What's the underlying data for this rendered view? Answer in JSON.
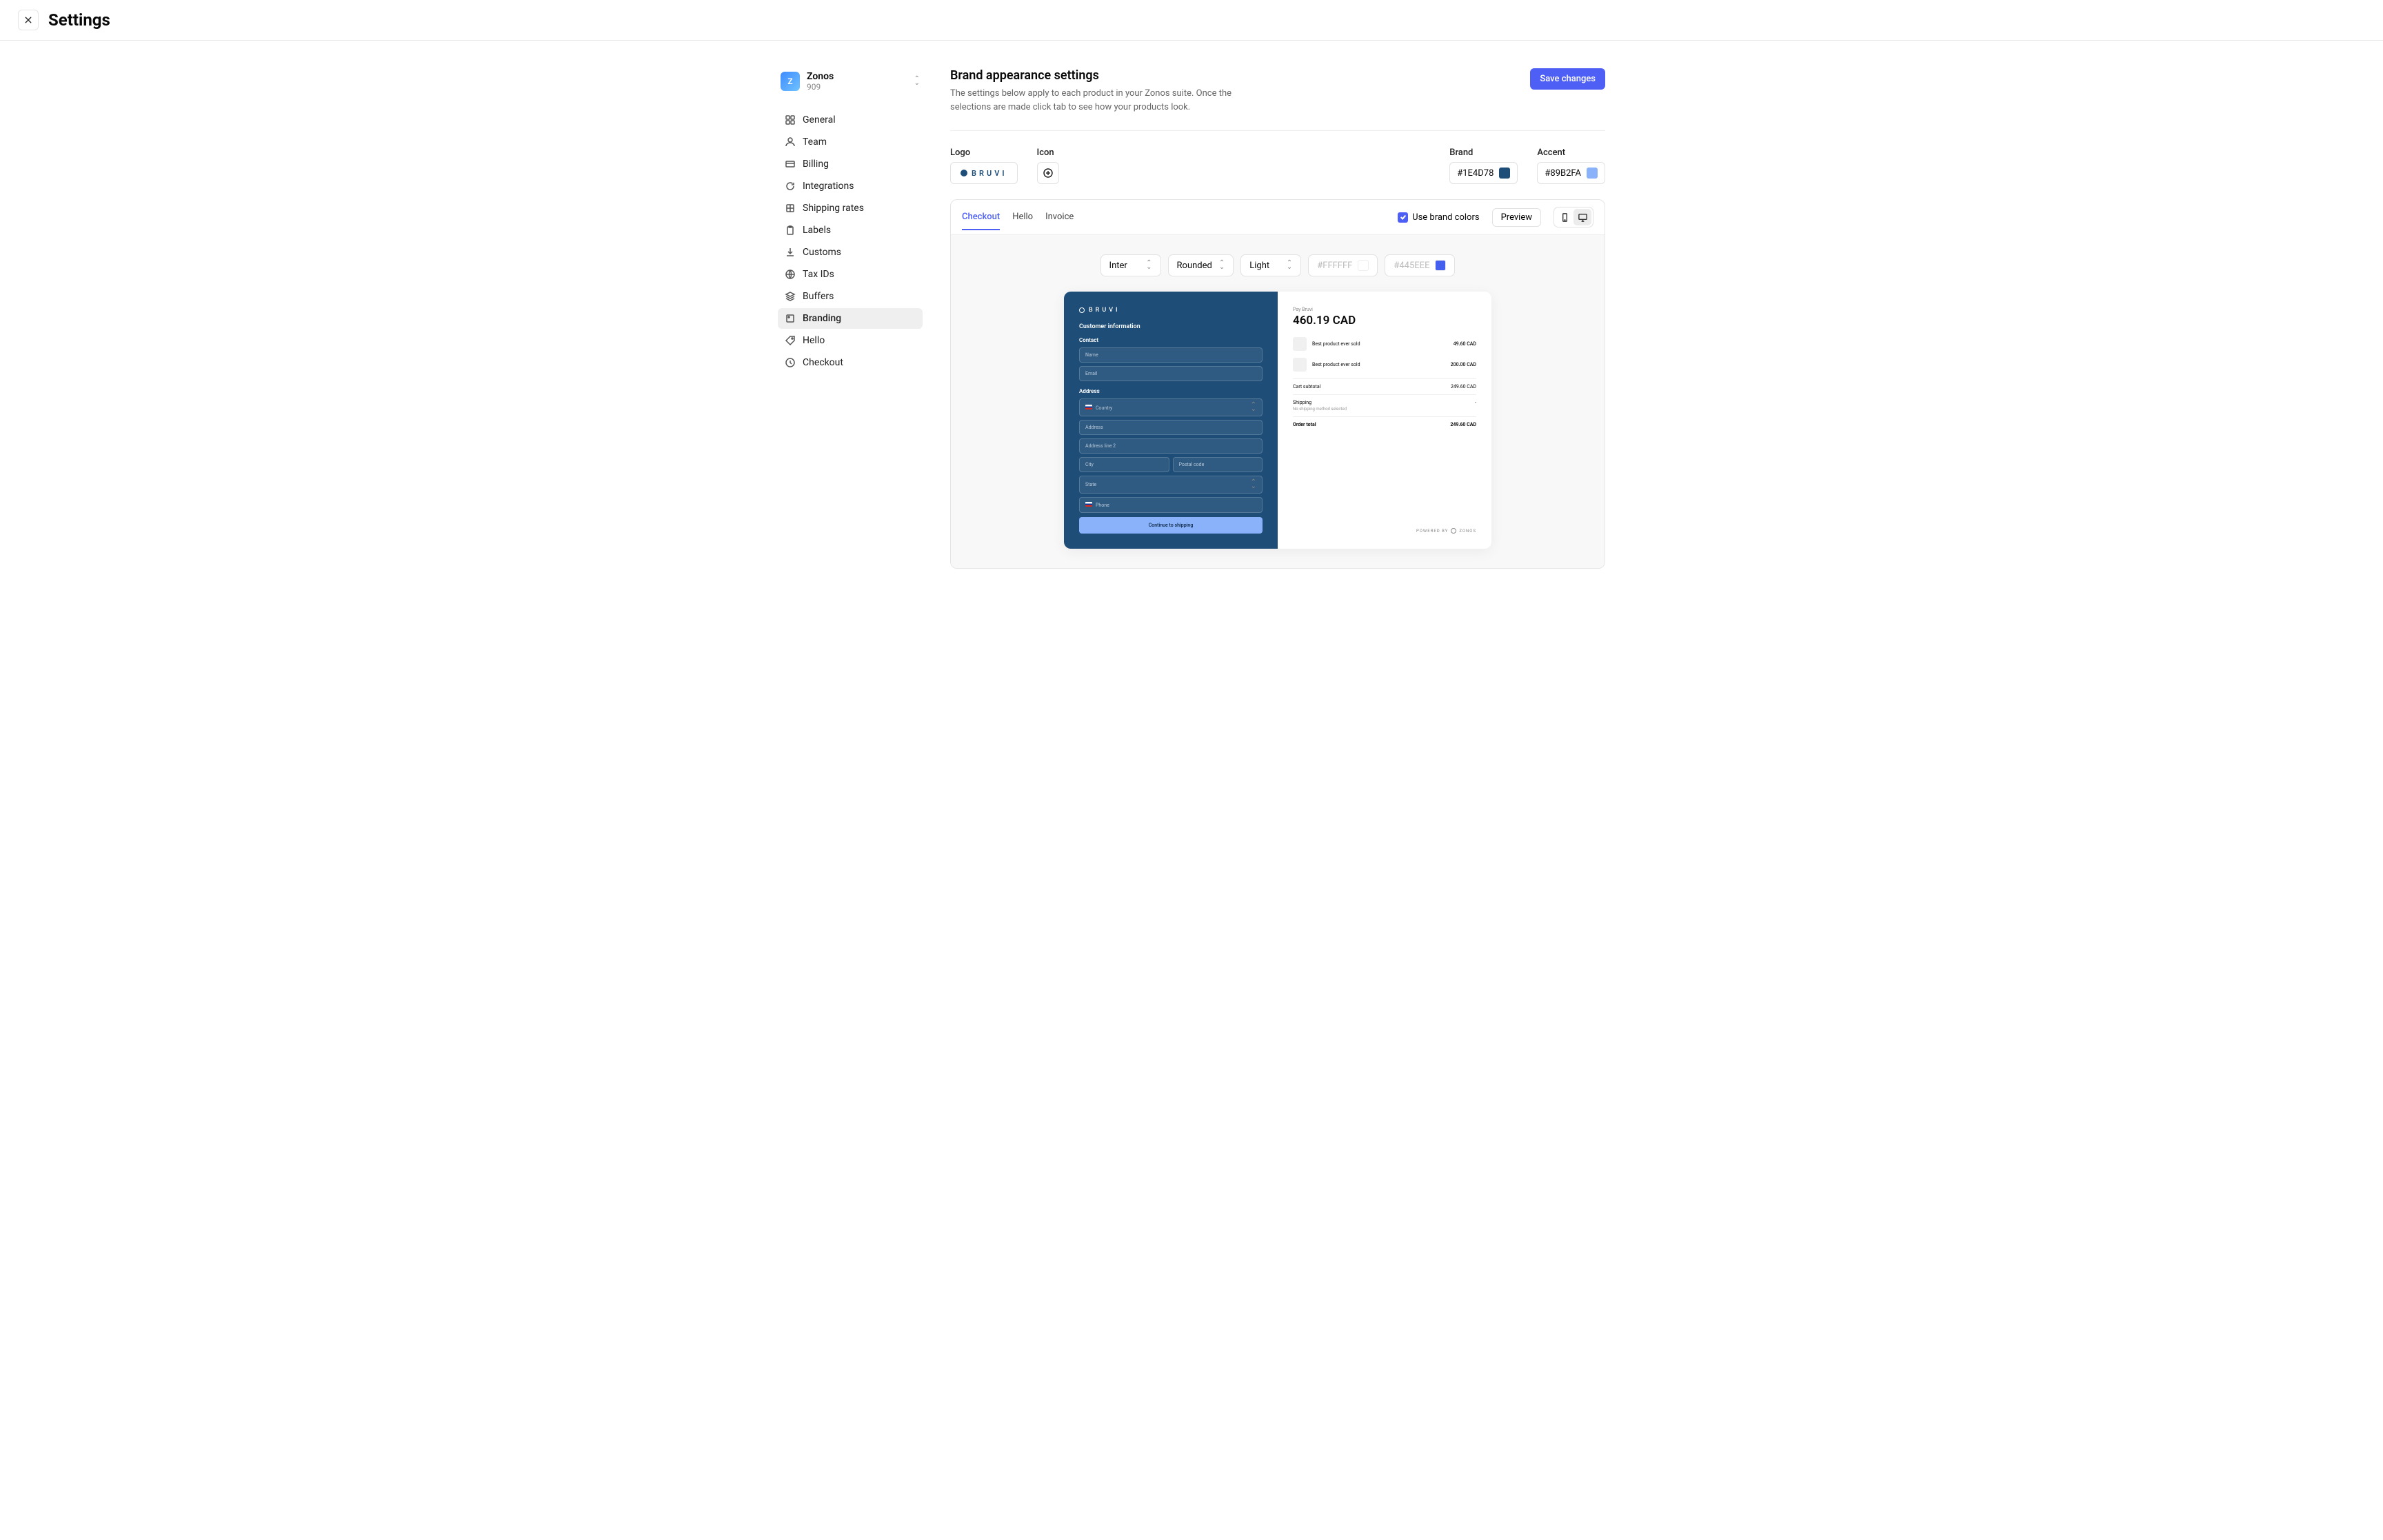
{
  "page": {
    "title": "Settings"
  },
  "org": {
    "avatar_letter": "Z",
    "name": "Zonos",
    "id": "909"
  },
  "sidebar": {
    "items": [
      {
        "label": "General"
      },
      {
        "label": "Team"
      },
      {
        "label": "Billing"
      },
      {
        "label": "Integrations"
      },
      {
        "label": "Shipping rates"
      },
      {
        "label": "Labels"
      },
      {
        "label": "Customs"
      },
      {
        "label": "Tax IDs"
      },
      {
        "label": "Buffers"
      },
      {
        "label": "Branding"
      },
      {
        "label": "Hello"
      },
      {
        "label": "Checkout"
      }
    ],
    "active_index": 9
  },
  "heading": {
    "title": "Brand appearance settings",
    "subtitle": "The settings below apply to each product in your Zonos suite. Once the selections are made click tab to see how your products look.",
    "save_label": "Save changes"
  },
  "fields": {
    "logo_label": "Logo",
    "logo_text": "BRUVI",
    "icon_label": "Icon",
    "brand_label": "Brand",
    "brand_value": "#1E4D78",
    "accent_label": "Accent",
    "accent_value": "#89B2FA"
  },
  "preview": {
    "tabs": [
      {
        "label": "Checkout"
      },
      {
        "label": "Hello"
      },
      {
        "label": "Invoice"
      }
    ],
    "active_tab": 0,
    "use_brand_colors_label": "Use brand colors",
    "use_brand_colors": true,
    "preview_btn": "Preview",
    "controls": {
      "font": "Inter",
      "corners": "Rounded",
      "theme": "Light",
      "bg": "#FFFFFF",
      "accent": "#445EEE"
    }
  },
  "mock": {
    "logo": "BRUVI",
    "section": "Customer information",
    "contact_label": "Contact",
    "name_ph": "Name",
    "email_ph": "Email",
    "address_label": "Address",
    "country_ph": "Country",
    "addr_ph": "Address",
    "addr2_ph": "Address line 2",
    "city_ph": "City",
    "postal_ph": "Postal code",
    "state_ph": "State",
    "phone_ph": "Phone",
    "cta": "Continue to shipping",
    "pay_label": "Pay Bruvi",
    "pay_amount": "460.19 CAD",
    "items": [
      {
        "name": "Best product ever sold",
        "price": "49.60 CAD"
      },
      {
        "name": "Best product ever sold",
        "price": "200.00 CAD"
      }
    ],
    "subtotal_label": "Cart subtotal",
    "subtotal_value": "249.60 CAD",
    "shipping_label": "Shipping",
    "shipping_value": "-",
    "shipping_sub": "No shipping method selected",
    "total_label": "Order total",
    "total_value": "249.60 CAD",
    "powered_prefix": "POWERED BY",
    "powered_brand": "ZONOS"
  }
}
